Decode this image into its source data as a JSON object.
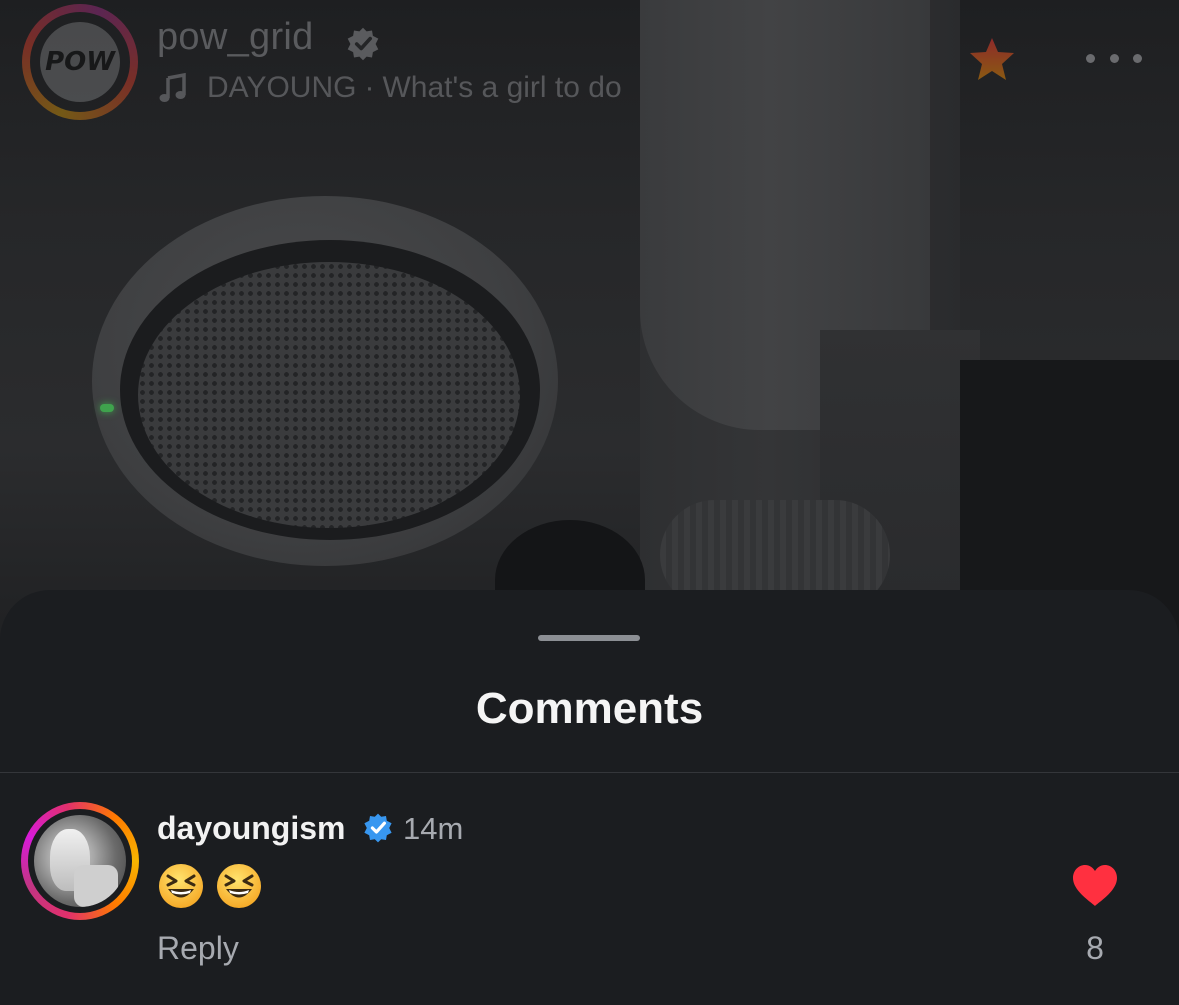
{
  "header": {
    "account_name": "pow_grid",
    "avatar_logo_text": "POW",
    "music_artist": "DAYOUNG",
    "music_separator": "·",
    "music_title": "What's a girl to do"
  },
  "icons": {
    "verified": "verified-badge-icon",
    "music": "music-note-icon",
    "favorite": "star-icon",
    "more": "more-options-icon",
    "like": "heart-icon"
  },
  "colors": {
    "verified_blue": "#3897f0",
    "like_red": "#ff3040",
    "sheet_background": "#1b1d20"
  },
  "comments_sheet": {
    "title": "Comments",
    "comments": [
      {
        "username": "dayoungism",
        "verified": true,
        "time": "14m",
        "text": "😆😆",
        "reply_label": "Reply",
        "liked": true,
        "like_count": "8"
      }
    ]
  }
}
